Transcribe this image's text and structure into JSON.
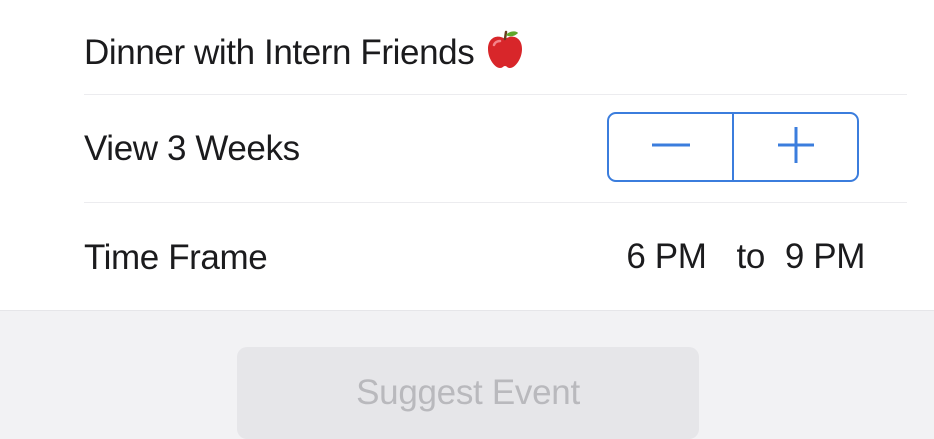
{
  "event": {
    "title": "Dinner with Intern Friends",
    "title_icon": "red-apple-icon"
  },
  "weeks": {
    "label": "View 3 Weeks",
    "decrement_icon": "minus-icon",
    "increment_icon": "plus-icon"
  },
  "time_frame": {
    "label": "Time Frame",
    "start": "6 PM",
    "separator": "to",
    "end": "9 PM"
  },
  "actions": {
    "suggest_label": "Suggest Event",
    "suggest_enabled": false
  },
  "colors": {
    "accent": "#3b7ddd",
    "disabled_bg": "#e6e6e9",
    "disabled_text": "#b9b9bd"
  }
}
